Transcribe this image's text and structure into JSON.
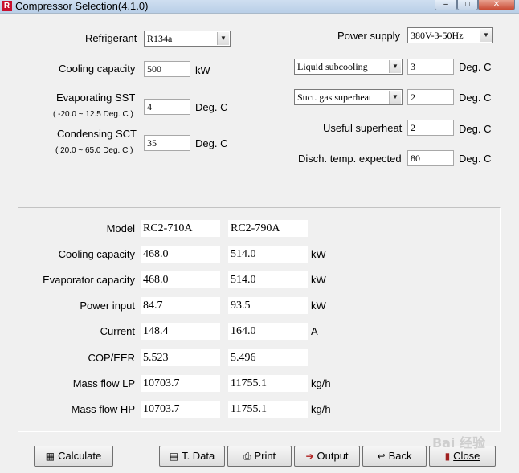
{
  "window": {
    "title": "Compressor Selection(4.1.0)",
    "app_icon_glyph": "R",
    "controls": {
      "minimize": "–",
      "maximize": "□",
      "close": "✕"
    }
  },
  "inputs": {
    "refrigerant": {
      "label": "Refrigerant",
      "value": "R134a"
    },
    "power_supply": {
      "label": "Power supply",
      "value": "380V-3-50Hz"
    },
    "cooling_capacity": {
      "label": "Cooling capacity",
      "value": "500",
      "unit": "kW"
    },
    "evaporating_sst": {
      "label": "Evaporating SST",
      "range": "( -20.0 ~ 12.5 Deg. C )",
      "value": "4",
      "unit": "Deg. C"
    },
    "condensing_sct": {
      "label": "Condensing SCT",
      "range": "( 20.0 ~ 65.0 Deg. C )",
      "value": "35",
      "unit": "Deg. C"
    },
    "liquid_subcooling": {
      "option": "Liquid subcooling",
      "value": "3",
      "unit": "Deg. C"
    },
    "suction_superheat": {
      "option": "Suct. gas superheat",
      "value": "2",
      "unit": "Deg. C"
    },
    "useful_superheat": {
      "label": "Useful superheat",
      "value": "2",
      "unit": "Deg. C"
    },
    "discharge_temp": {
      "label": "Disch. temp. expected",
      "value": "80",
      "unit": "Deg. C"
    }
  },
  "results": {
    "rows": [
      {
        "label": "Model",
        "v1": "RC2-710A",
        "v2": "RC2-790A",
        "unit": ""
      },
      {
        "label": "Cooling capacity",
        "v1": "468.0",
        "v2": "514.0",
        "unit": "kW"
      },
      {
        "label": "Evaporator capacity",
        "v1": "468.0",
        "v2": "514.0",
        "unit": "kW"
      },
      {
        "label": "Power input",
        "v1": "84.7",
        "v2": "93.5",
        "unit": "kW"
      },
      {
        "label": "Current",
        "v1": "148.4",
        "v2": "164.0",
        "unit": "A"
      },
      {
        "label": "COP/EER",
        "v1": "5.523",
        "v2": "5.496",
        "unit": ""
      },
      {
        "label": "Mass flow LP",
        "v1": "10703.7",
        "v2": "11755.1",
        "unit": "kg/h"
      },
      {
        "label": "Mass flow HP",
        "v1": "10703.7",
        "v2": "11755.1",
        "unit": "kg/h"
      }
    ]
  },
  "buttons": {
    "calculate": "Calculate",
    "tdata": "T. Data",
    "print": "Print",
    "output": "Output",
    "back": "Back",
    "close": "Close"
  },
  "watermark": "Bai 经验"
}
